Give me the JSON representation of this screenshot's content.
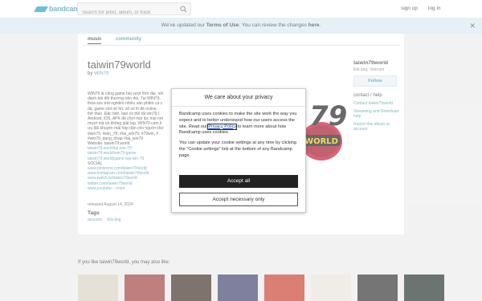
{
  "header": {
    "logo_text": "bandcamp",
    "search_placeholder": "Search for artist, album, or track",
    "signup": "sign up",
    "login": "log in"
  },
  "notice": {
    "prefix": "We've updated our ",
    "terms": "Terms of Use",
    "middle": ". You can review the changes ",
    "here": "here",
    "suffix": "."
  },
  "tabs": [
    {
      "label": "music"
    },
    {
      "label": "community"
    }
  ],
  "release": {
    "title": "taiwin79world",
    "by_prefix": "by ",
    "artist": "WIN79",
    "description_lines": [
      "WIN79 là cổng game bài vượt thời đại, nổi",
      "đánh bài đổi thưởng trên thịt. Tại WIN79,",
      "thỏa sức trải nghiệm nhiều sản phẩm cá c",
      "đá, game slot nổ hũ, xổ số lô đề online,",
      "thể thao. Đặc biệt, bạn có thể tải win79 t",
      "Android, iOS, APK để chơi mọi lúc mọi nơi",
      "mượt mà và không giật lag. WIN79 cam k",
      "ưu đãi khuyến mãi hấp dẫn cho người chơ",
      "#win79, #win_79, #tai_win79, #79win, #",
      "#win79_dang_nhap #tai_win79",
      "Website: taiwin79.world",
      "taiwin79.world/tai-win-79",
      "taiwin79.world/win79-game",
      "taiwin79.world/game-bai-win-79",
      "SOCIAL",
      "www.pinterest.com/taiwin79world",
      "www.instagram.com/taiwin79world",
      "www.twitch.tv/taiwin79world",
      "twitter.com/taiwin79world",
      "www.youtube...  more"
    ],
    "released": "released August 14, 2024",
    "tags_header": "Tags",
    "tags": [
      "acoustic",
      "Đài ăng"
    ],
    "art_text": "WORLD"
  },
  "sidebar": {
    "name": "taiwin79world",
    "location": "Đài ăng, Vietnam",
    "follow": "Follow",
    "contact_header": "contact / help",
    "links": [
      "Contact taiwin79world",
      "Streaming and Download help",
      "Report this album or account"
    ]
  },
  "ymal": {
    "title": "If you like taiwin79world, you may also like:",
    "thumbs": [
      "#d9d2c1",
      "#9b3b3a",
      "#3a2a1f",
      "#3b3b6b",
      "#c83a2a",
      "#e8e4dc",
      "#2b2b2b",
      "#1d2a24"
    ]
  },
  "modal": {
    "title": "We care about your privacy",
    "p1_before": "Bandcamp uses cookies to make the site work the way you expect and to better understand how our users access the site. Read our ",
    "p1_link": "Privacy Policy",
    "p1_after": " to learn more about how Bandcamp uses cookies.",
    "p2": "You can update your cookie settings at any time by clicking the \"Cookie settings\" link at the bottom of any Bandcamp page.",
    "accept_all": "Accept all",
    "accept_necessary": "Accept necessary only"
  },
  "colors": {
    "accent": "#408ea3",
    "notice_bg": "#d7eaf3",
    "page_bg": "#ececec"
  }
}
